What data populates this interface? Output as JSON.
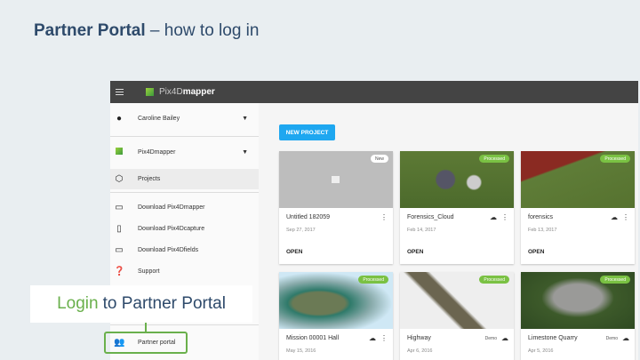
{
  "slide": {
    "title_bold": "Partner Portal",
    "title_rest": " – how to log in"
  },
  "app": {
    "name_light": "Pix4D",
    "name_bold": "mapper"
  },
  "sidebar": {
    "items": [
      {
        "label": "Caroline Bailey",
        "icon": "account-circle-icon"
      },
      {
        "label": "Pix4Dmapper",
        "icon": "pix4d-logo-icon"
      },
      {
        "label": "Projects",
        "icon": "cube-icon"
      },
      {
        "label": "Download Pix4Dmapper",
        "icon": "monitor-icon"
      },
      {
        "label": "Download Pix4Dcapture",
        "icon": "phone-icon"
      },
      {
        "label": "Download Pix4Dfields",
        "icon": "monitor-icon"
      },
      {
        "label": "Support",
        "icon": "help-icon"
      },
      {
        "label": "Partner portal",
        "icon": "people-icon"
      }
    ]
  },
  "main": {
    "new_project": "NEW PROJECT",
    "cards": [
      {
        "title": "Untitled 182059",
        "date": "Sep 27, 2017",
        "badge": "New",
        "action": "OPEN"
      },
      {
        "title": "Forensics_Cloud",
        "date": "Feb 14, 2017",
        "badge": "Processed",
        "action": "OPEN"
      },
      {
        "title": "forensics",
        "date": "Feb 13, 2017",
        "badge": "Processed",
        "action": "OPEN"
      },
      {
        "title": "Mission 00001 Hall",
        "date": "May 15, 2016",
        "badge": "Processed"
      },
      {
        "title": "Highway",
        "date": "Apr 6, 2016",
        "badge": "Processed",
        "demo": "Demo"
      },
      {
        "title": "Limestone Quarry",
        "date": "Apr 5, 2016",
        "badge": "Processed",
        "demo": "Demo"
      }
    ]
  },
  "callout": {
    "highlight": "Login",
    "rest": "to Partner Portal"
  },
  "colors": {
    "accent": "#6ab04c",
    "title": "#2e4a6b",
    "button": "#1ea7f0"
  }
}
